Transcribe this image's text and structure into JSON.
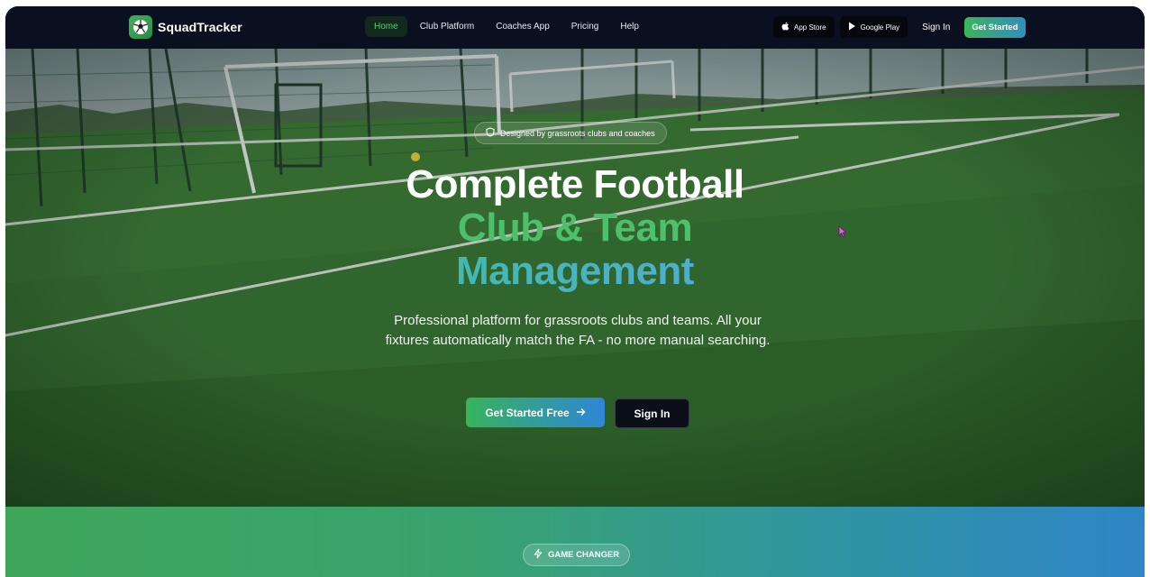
{
  "nav": {
    "brand": "SquadTracker",
    "links": [
      {
        "label": "Home",
        "active": true
      },
      {
        "label": "Club Platform",
        "active": false
      },
      {
        "label": "Coaches App",
        "active": false
      },
      {
        "label": "Pricing",
        "active": false
      },
      {
        "label": "Help",
        "active": false
      }
    ],
    "app_store": "App Store",
    "google_play": "Google Play",
    "sign_in": "Sign In",
    "get_started": "Get Started"
  },
  "hero": {
    "badge": "Designed by grassroots clubs and coaches",
    "title_line1": "Complete Football",
    "title_line2": "Club & Team",
    "title_line3": "Management",
    "subtitle": "Professional platform for grassroots clubs and teams. All your fixtures automatically match the FA - no more manual searching.",
    "cta_primary": "Get Started Free",
    "cta_secondary": "Sign In"
  },
  "band": {
    "badge": "GAME CHANGER"
  },
  "colors": {
    "nav_bg": "#0b1020",
    "accent_green": "#3cb45a",
    "accent_blue": "#2f86d6",
    "active_link": "#4fd36d"
  },
  "icons": [
    "soccer-ball-icon",
    "apple-icon",
    "play-store-icon",
    "shield-icon",
    "arrow-right-icon",
    "lightning-icon",
    "mouse-cursor-icon"
  ]
}
